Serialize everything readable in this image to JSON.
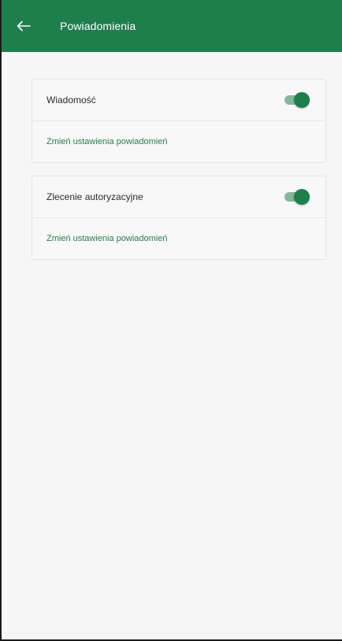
{
  "app_bar": {
    "title": "Powiadomienia",
    "back_icon": "arrow-left-icon",
    "background": "#1e7e4d"
  },
  "cards": [
    {
      "label": "Wiadomość",
      "toggle_on": true,
      "link": "Zmień ustawienia powiadomień"
    },
    {
      "label": "Zlecenie autoryzacyjne",
      "toggle_on": true,
      "link": "Zmień ustawienia powiadomień"
    }
  ],
  "colors": {
    "accent": "#1e7e4d",
    "toggle_track": "#86b79c",
    "link": "#2a7a52"
  }
}
